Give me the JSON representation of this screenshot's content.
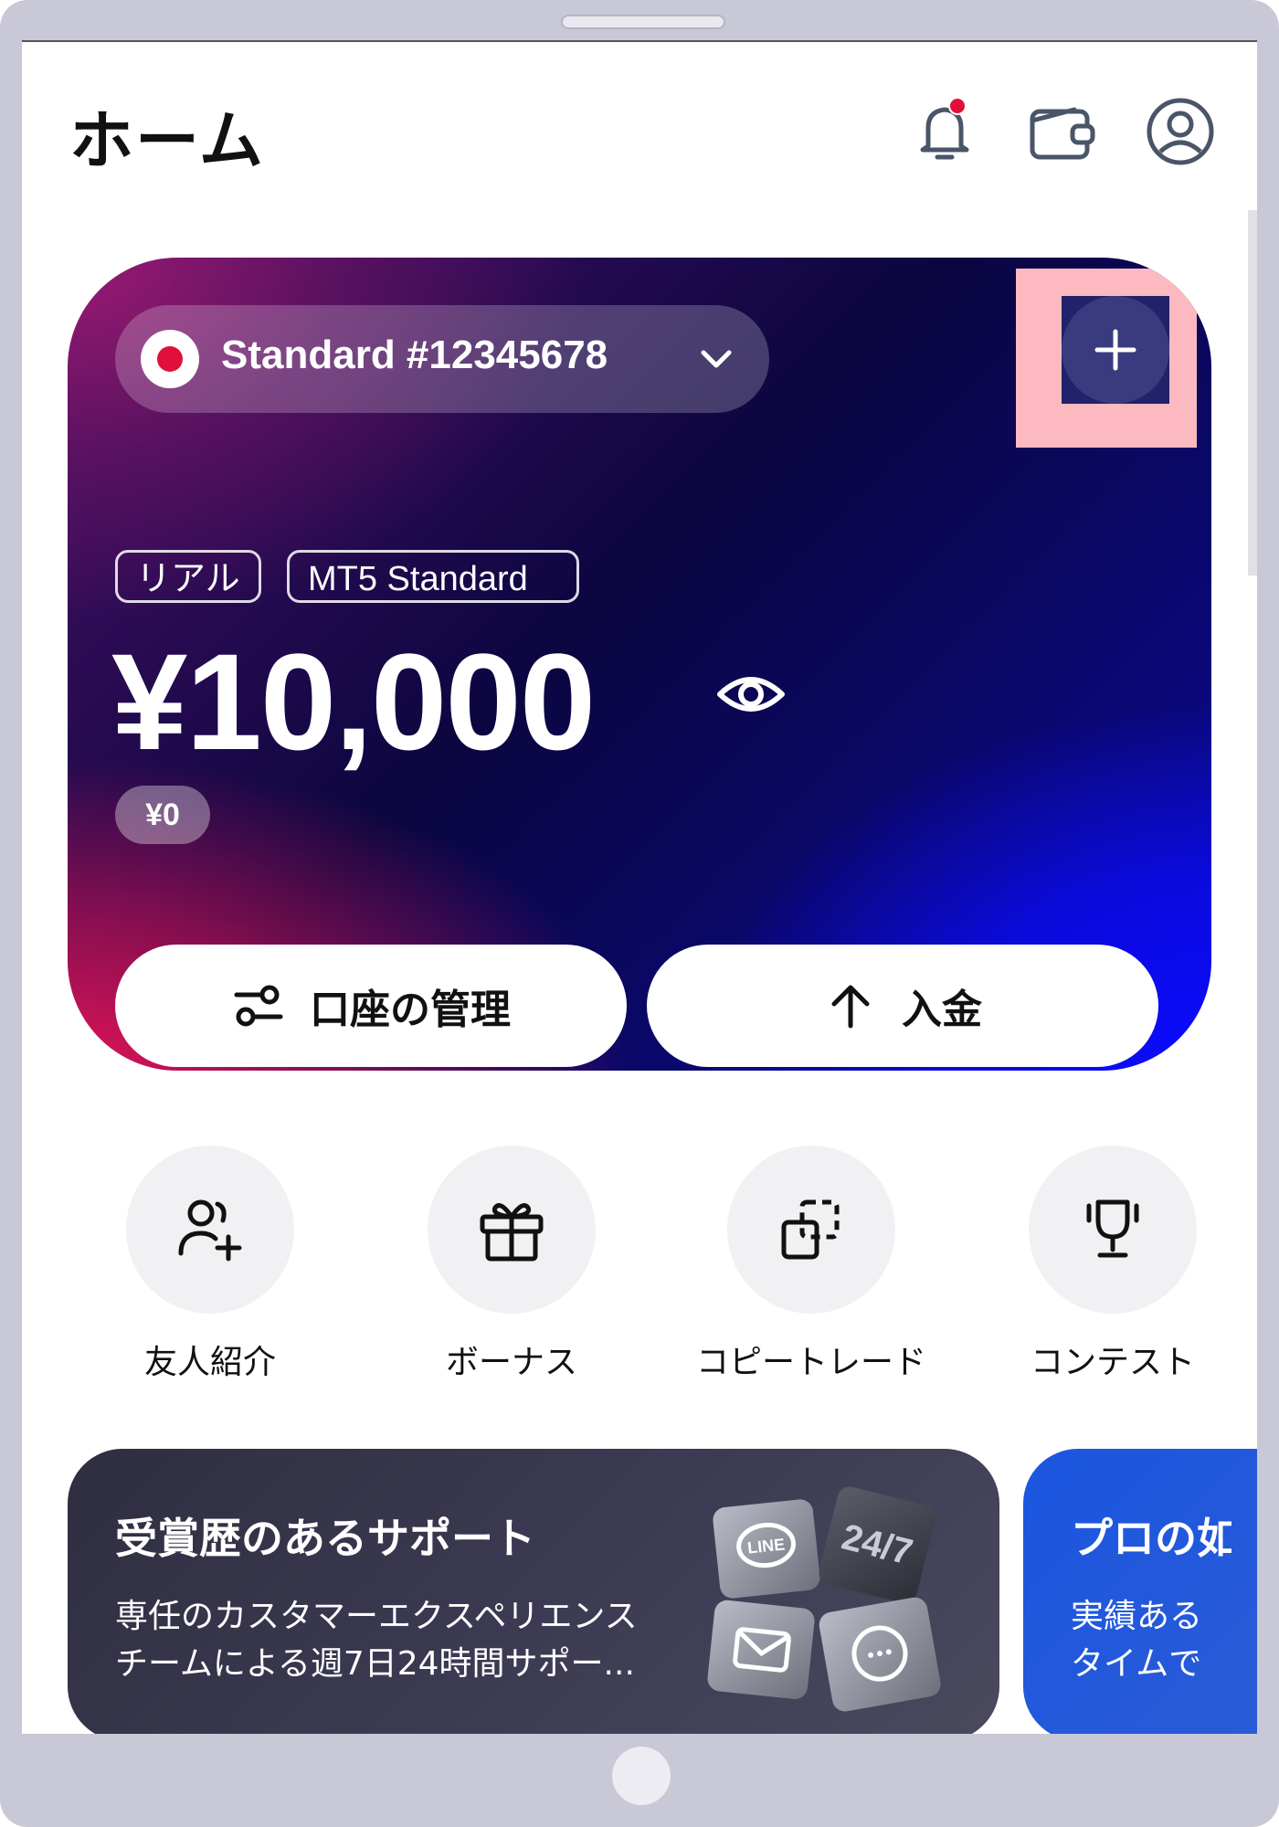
{
  "header": {
    "title": "ホーム",
    "icons": [
      "bell-icon",
      "wallet-icon",
      "profile-icon"
    ],
    "notification_dot_color": "#e0103a"
  },
  "account_card": {
    "account_name": "Standard #12345678",
    "tags": [
      "リアル",
      "MT5 Standard"
    ],
    "balance": "¥10,000",
    "sub_balance": "¥0",
    "buttons": {
      "manage": "口座の管理",
      "deposit": "入金"
    },
    "colors": {
      "gradient_pink": "#e01458",
      "gradient_blue": "#0b0bff",
      "gradient_dark": "#0b0640"
    }
  },
  "quick_actions": [
    {
      "label": "友人紹介",
      "icon": "add-user-icon"
    },
    {
      "label": "ボーナス",
      "icon": "gift-icon"
    },
    {
      "label": "コピートレード",
      "icon": "copy-icon"
    },
    {
      "label": "コンテスト",
      "icon": "trophy-icon"
    }
  ],
  "promos": [
    {
      "title": "受賞歴のあるサポート",
      "desc_line1": "専任のカスタマーエクスペリエンス",
      "desc_line2": "チームによる週7日24時間サポー...",
      "art_labels": [
        "LINE",
        "24/7"
      ]
    },
    {
      "title": "プロの如",
      "desc_line1": "実績ある",
      "desc_line2": "タイムで"
    }
  ]
}
